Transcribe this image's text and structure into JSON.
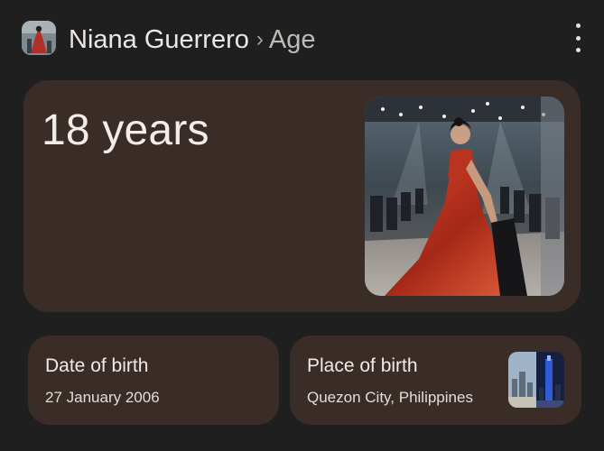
{
  "header": {
    "person_name": "Niana Guerrero",
    "separator": "›",
    "page": "Age",
    "menu_icon": "more-vert-icon"
  },
  "age": {
    "value": "18 years"
  },
  "date_of_birth": {
    "title": "Date of birth",
    "value": "27 January 2006"
  },
  "place_of_birth": {
    "title": "Place of birth",
    "value": "Quezon City, Philippines"
  },
  "colors": {
    "page_background": "#1f1f1f",
    "card_background": "#3a2d28",
    "text_primary": "#f2ede9"
  }
}
